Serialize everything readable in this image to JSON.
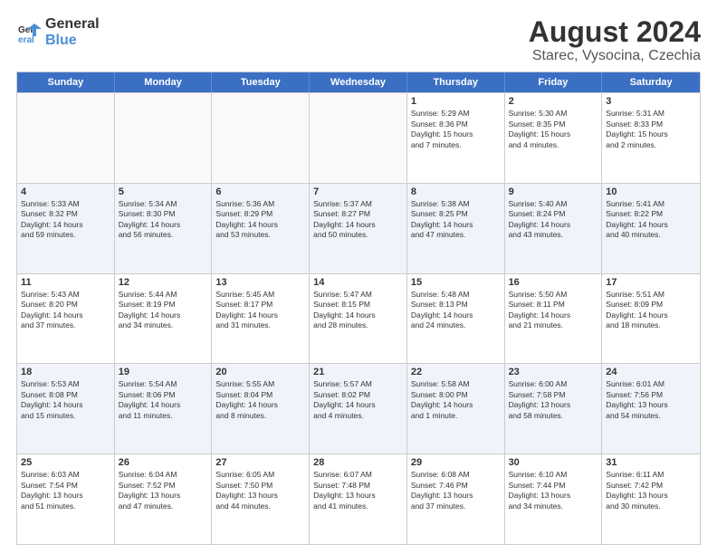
{
  "header": {
    "logo_line1": "General",
    "logo_line2": "Blue",
    "title": "August 2024",
    "subtitle": "Starec, Vysocina, Czechia"
  },
  "weekdays": [
    "Sunday",
    "Monday",
    "Tuesday",
    "Wednesday",
    "Thursday",
    "Friday",
    "Saturday"
  ],
  "rows": [
    [
      {
        "day": "",
        "info": "",
        "empty": true
      },
      {
        "day": "",
        "info": "",
        "empty": true
      },
      {
        "day": "",
        "info": "",
        "empty": true
      },
      {
        "day": "",
        "info": "",
        "empty": true
      },
      {
        "day": "1",
        "info": "Sunrise: 5:29 AM\nSunset: 8:36 PM\nDaylight: 15 hours\nand 7 minutes."
      },
      {
        "day": "2",
        "info": "Sunrise: 5:30 AM\nSunset: 8:35 PM\nDaylight: 15 hours\nand 4 minutes."
      },
      {
        "day": "3",
        "info": "Sunrise: 5:31 AM\nSunset: 8:33 PM\nDaylight: 15 hours\nand 2 minutes."
      }
    ],
    [
      {
        "day": "4",
        "info": "Sunrise: 5:33 AM\nSunset: 8:32 PM\nDaylight: 14 hours\nand 59 minutes."
      },
      {
        "day": "5",
        "info": "Sunrise: 5:34 AM\nSunset: 8:30 PM\nDaylight: 14 hours\nand 56 minutes."
      },
      {
        "day": "6",
        "info": "Sunrise: 5:36 AM\nSunset: 8:29 PM\nDaylight: 14 hours\nand 53 minutes."
      },
      {
        "day": "7",
        "info": "Sunrise: 5:37 AM\nSunset: 8:27 PM\nDaylight: 14 hours\nand 50 minutes."
      },
      {
        "day": "8",
        "info": "Sunrise: 5:38 AM\nSunset: 8:25 PM\nDaylight: 14 hours\nand 47 minutes."
      },
      {
        "day": "9",
        "info": "Sunrise: 5:40 AM\nSunset: 8:24 PM\nDaylight: 14 hours\nand 43 minutes."
      },
      {
        "day": "10",
        "info": "Sunrise: 5:41 AM\nSunset: 8:22 PM\nDaylight: 14 hours\nand 40 minutes."
      }
    ],
    [
      {
        "day": "11",
        "info": "Sunrise: 5:43 AM\nSunset: 8:20 PM\nDaylight: 14 hours\nand 37 minutes."
      },
      {
        "day": "12",
        "info": "Sunrise: 5:44 AM\nSunset: 8:19 PM\nDaylight: 14 hours\nand 34 minutes."
      },
      {
        "day": "13",
        "info": "Sunrise: 5:45 AM\nSunset: 8:17 PM\nDaylight: 14 hours\nand 31 minutes."
      },
      {
        "day": "14",
        "info": "Sunrise: 5:47 AM\nSunset: 8:15 PM\nDaylight: 14 hours\nand 28 minutes."
      },
      {
        "day": "15",
        "info": "Sunrise: 5:48 AM\nSunset: 8:13 PM\nDaylight: 14 hours\nand 24 minutes."
      },
      {
        "day": "16",
        "info": "Sunrise: 5:50 AM\nSunset: 8:11 PM\nDaylight: 14 hours\nand 21 minutes."
      },
      {
        "day": "17",
        "info": "Sunrise: 5:51 AM\nSunset: 8:09 PM\nDaylight: 14 hours\nand 18 minutes."
      }
    ],
    [
      {
        "day": "18",
        "info": "Sunrise: 5:53 AM\nSunset: 8:08 PM\nDaylight: 14 hours\nand 15 minutes."
      },
      {
        "day": "19",
        "info": "Sunrise: 5:54 AM\nSunset: 8:06 PM\nDaylight: 14 hours\nand 11 minutes."
      },
      {
        "day": "20",
        "info": "Sunrise: 5:55 AM\nSunset: 8:04 PM\nDaylight: 14 hours\nand 8 minutes."
      },
      {
        "day": "21",
        "info": "Sunrise: 5:57 AM\nSunset: 8:02 PM\nDaylight: 14 hours\nand 4 minutes."
      },
      {
        "day": "22",
        "info": "Sunrise: 5:58 AM\nSunset: 8:00 PM\nDaylight: 14 hours\nand 1 minute."
      },
      {
        "day": "23",
        "info": "Sunrise: 6:00 AM\nSunset: 7:58 PM\nDaylight: 13 hours\nand 58 minutes."
      },
      {
        "day": "24",
        "info": "Sunrise: 6:01 AM\nSunset: 7:56 PM\nDaylight: 13 hours\nand 54 minutes."
      }
    ],
    [
      {
        "day": "25",
        "info": "Sunrise: 6:03 AM\nSunset: 7:54 PM\nDaylight: 13 hours\nand 51 minutes."
      },
      {
        "day": "26",
        "info": "Sunrise: 6:04 AM\nSunset: 7:52 PM\nDaylight: 13 hours\nand 47 minutes."
      },
      {
        "day": "27",
        "info": "Sunrise: 6:05 AM\nSunset: 7:50 PM\nDaylight: 13 hours\nand 44 minutes."
      },
      {
        "day": "28",
        "info": "Sunrise: 6:07 AM\nSunset: 7:48 PM\nDaylight: 13 hours\nand 41 minutes."
      },
      {
        "day": "29",
        "info": "Sunrise: 6:08 AM\nSunset: 7:46 PM\nDaylight: 13 hours\nand 37 minutes."
      },
      {
        "day": "30",
        "info": "Sunrise: 6:10 AM\nSunset: 7:44 PM\nDaylight: 13 hours\nand 34 minutes."
      },
      {
        "day": "31",
        "info": "Sunrise: 6:11 AM\nSunset: 7:42 PM\nDaylight: 13 hours\nand 30 minutes."
      }
    ]
  ]
}
